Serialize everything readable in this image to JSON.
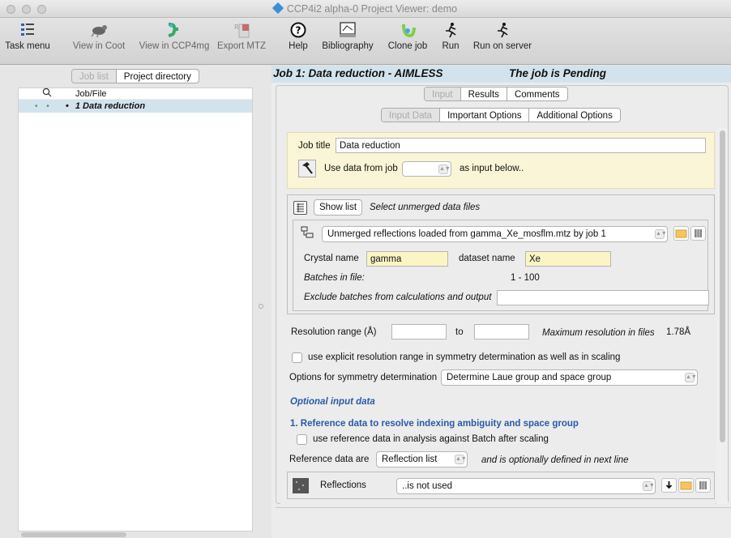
{
  "window": {
    "title": "CCP4i2 alpha-0 Project Viewer: demo"
  },
  "toolbar": {
    "task_menu": "Task menu",
    "view_coot": "View in Coot",
    "view_ccp4mg": "View in CCP4mg",
    "export_mtz": "Export MTZ",
    "help": "Help",
    "bibliography": "Bibliography",
    "clone_job": "Clone job",
    "run": "Run",
    "run_on_server": "Run on server"
  },
  "left": {
    "tabs": [
      "Job list",
      "Project directory"
    ],
    "tree_header": "Job/File",
    "job_row": "1 Data reduction"
  },
  "job": {
    "title": "Job 1:  Data reduction - AIMLESS",
    "status": "The job is Pending"
  },
  "tabs_main": [
    "Input",
    "Results",
    "Comments"
  ],
  "tabs_sub": [
    "Input Data",
    "Important Options",
    "Additional Options"
  ],
  "form": {
    "job_title_label": "Job title",
    "job_title_value": "Data reduction",
    "use_data_label": "Use data from job",
    "use_data_suffix": "as input below..",
    "show_list": "Show list",
    "select_unmerged": "Select unmerged data files",
    "unmerged_value": "Unmerged reflections loaded from gamma_Xe_mosflm.mtz by job 1",
    "crystal_name_label": "Crystal name",
    "crystal_name_value": "gamma",
    "dataset_name_label": "dataset name",
    "dataset_name_value": "Xe",
    "batches_label": "Batches in file:",
    "batches_value": "1 - 100",
    "exclude_label": "Exclude batches from calculations and output",
    "resolution_label": "Resolution range (Å)",
    "to_label": "to",
    "max_res_label": "Maximum resolution in files",
    "max_res_value": "1.78Å",
    "explicit_res": "use explicit resolution range in symmetry determination as well as in scaling",
    "sym_label": "Options for symmetry determination",
    "sym_value": "Determine Laue group and space group",
    "optional": "Optional input data",
    "ref_section": "1. Reference data to resolve indexing ambiguity and space group",
    "ref_check": "use reference data in analysis against Batch after scaling",
    "ref_are_label": "Reference data are",
    "ref_are_value": "Reflection list",
    "ref_are_suffix": "and is optionally defined in next line",
    "reflections_label": "Reflections",
    "reflections_value": "..is not used"
  }
}
